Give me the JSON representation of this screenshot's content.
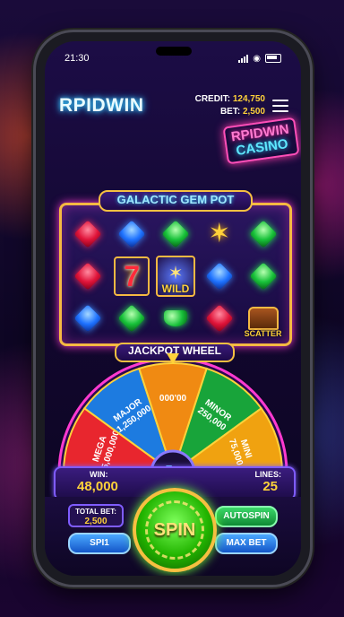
{
  "status": {
    "time": "21:30"
  },
  "header": {
    "logo": "RPIDWIN",
    "credit_label": "CREDIT:",
    "credit_value": "124,750",
    "bet_label": "BET:",
    "bet_value": "2,500"
  },
  "sign": {
    "line1": "RPIDWIN",
    "line2": "CASINO"
  },
  "game": {
    "title": "GALACTIC GEM POT",
    "wild_label": "WILD",
    "scatter_label": "SCATTER",
    "seven": "7"
  },
  "wheel": {
    "title": "JACKPOT WHEEL",
    "segments": [
      {
        "label": "MEGA",
        "value": "15,000,000",
        "color": "#e8262e"
      },
      {
        "label": "MAJOR",
        "value": "1,250,000",
        "color": "#1d7be0"
      },
      {
        "label": "",
        "value": "000'00",
        "color": "#f08a12"
      },
      {
        "label": "MINOR",
        "value": "250,000",
        "color": "#18a43a"
      },
      {
        "label": "MINI",
        "value": "75,000",
        "color": "#f0a210"
      }
    ]
  },
  "win": {
    "win_label": "WIN:",
    "win_value": "48,000",
    "lines_label": "LINES:",
    "lines_value": "25"
  },
  "controls": {
    "total_bet_label": "TOTAL BET:",
    "total_bet_value": "2,500",
    "spin_label": "SPIN",
    "spin_small": "SPI1",
    "autospin": "AUTOSPIN",
    "max_bet": "MAX BET"
  }
}
